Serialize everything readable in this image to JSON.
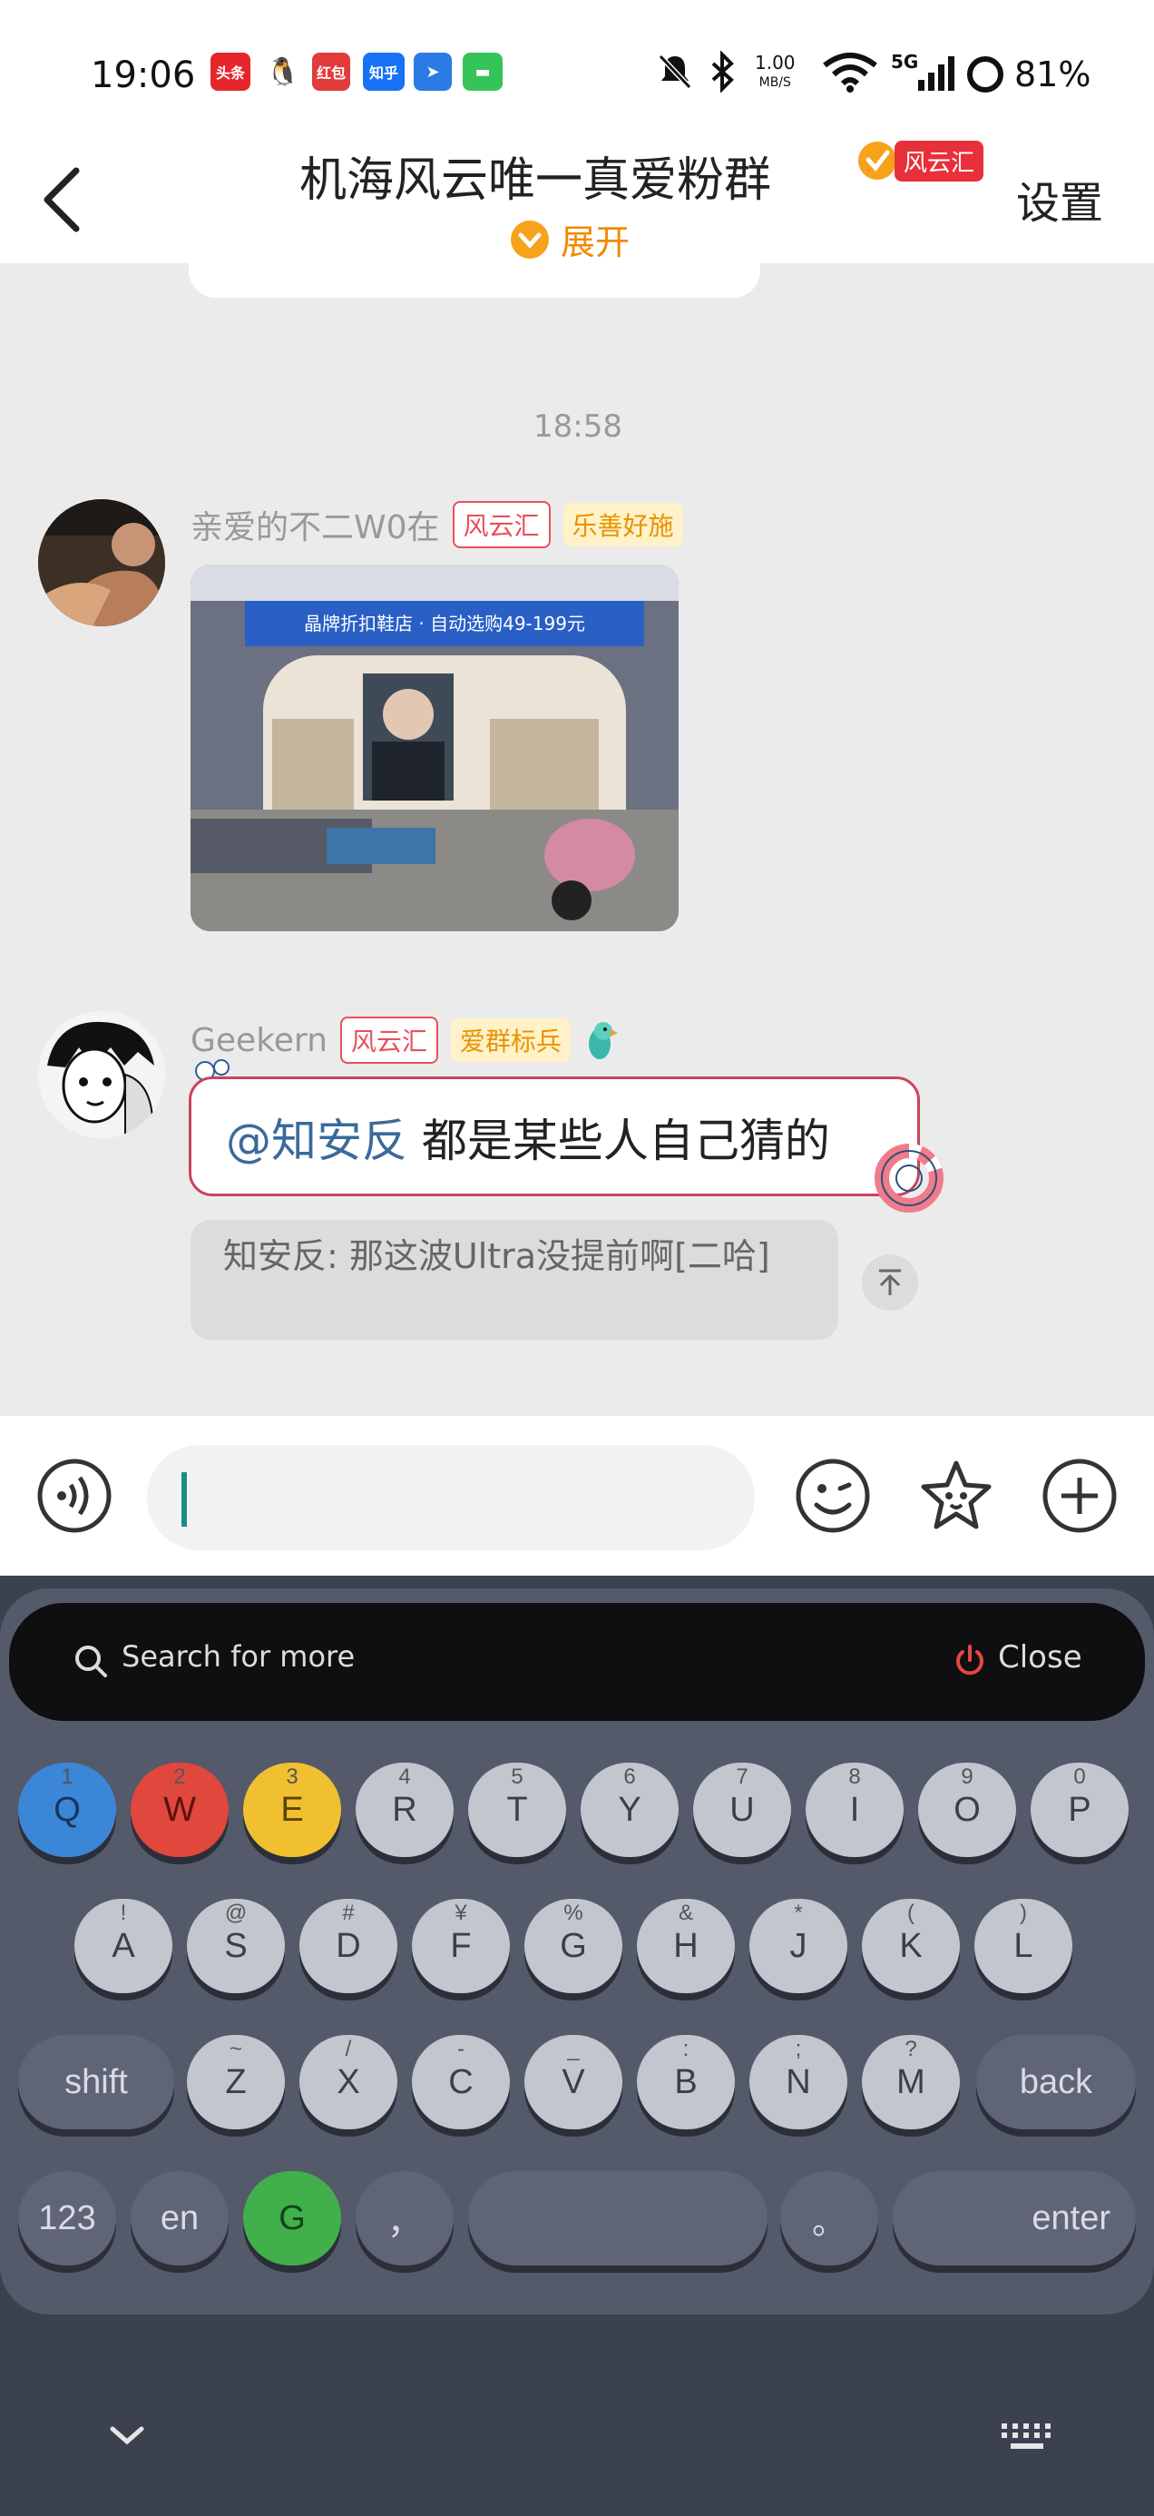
{
  "status_bar": {
    "time": "19:06",
    "net_speed_value": "1.00",
    "net_speed_unit": "MB/S",
    "signal_label": "5G",
    "battery": "81%",
    "app_icons": [
      "头条",
      "QQ",
      "红包",
      "知乎",
      "钉钉",
      "信息"
    ]
  },
  "header": {
    "back_label": "<",
    "title": "机海风云唯一真爱粉群",
    "title_badge": "风云汇",
    "expand_label": "展开",
    "settings_label": "设置"
  },
  "chat": {
    "time_divider": "18:58",
    "messages": [
      {
        "sender": "亲爱的不二W0在",
        "tags": [
          "风云汇",
          "乐善好施"
        ],
        "type": "image",
        "image": {
          "store_sign": "晶牌折扣鞋店 · 自动选购49-199元"
        }
      },
      {
        "sender": "Geekern",
        "tags": [
          "风云汇",
          "爱群标兵"
        ],
        "type": "text",
        "mention": "@知安反",
        "text": "都是某些人自己猜的",
        "quote": "知安反: 那这波Ultra没提前啊[二哈]"
      }
    ]
  },
  "input_bar": {
    "input_value": ""
  },
  "keyboard": {
    "search_placeholder": "Search for more",
    "close_label": "Close",
    "row1": [
      {
        "label": "Q",
        "sup": "1"
      },
      {
        "label": "W",
        "sup": "2"
      },
      {
        "label": "E",
        "sup": "3"
      },
      {
        "label": "R",
        "sup": "4"
      },
      {
        "label": "T",
        "sup": "5"
      },
      {
        "label": "Y",
        "sup": "6"
      },
      {
        "label": "U",
        "sup": "7"
      },
      {
        "label": "I",
        "sup": "8"
      },
      {
        "label": "O",
        "sup": "9"
      },
      {
        "label": "P",
        "sup": "0"
      }
    ],
    "row2": [
      {
        "label": "A",
        "sup": "!"
      },
      {
        "label": "S",
        "sup": "@"
      },
      {
        "label": "D",
        "sup": "#"
      },
      {
        "label": "F",
        "sup": "¥"
      },
      {
        "label": "G",
        "sup": "%"
      },
      {
        "label": "H",
        "sup": "&"
      },
      {
        "label": "J",
        "sup": "*"
      },
      {
        "label": "K",
        "sup": "("
      },
      {
        "label": "L",
        "sup": ")"
      }
    ],
    "row3": [
      {
        "label": "Z",
        "sup": "~"
      },
      {
        "label": "X",
        "sup": "/"
      },
      {
        "label": "C",
        "sup": "-"
      },
      {
        "label": "V",
        "sup": "_"
      },
      {
        "label": "B",
        "sup": ":"
      },
      {
        "label": "N",
        "sup": ";"
      },
      {
        "label": "M",
        "sup": "?"
      }
    ],
    "shift_label": "shift",
    "back_label": "back",
    "num_label": "123",
    "lang_label": "en",
    "g_label": "G",
    "comma_label": "，",
    "period_label": "。",
    "enter_label": "enter"
  },
  "colors": {
    "accent_orange": "#f08a00",
    "tag_red": "#e8505b",
    "mention_blue": "#3a6a9c",
    "key_blue": "#3c86d8",
    "key_red": "#e0473d",
    "key_yellow": "#f0c030",
    "key_green": "#42b04a"
  }
}
